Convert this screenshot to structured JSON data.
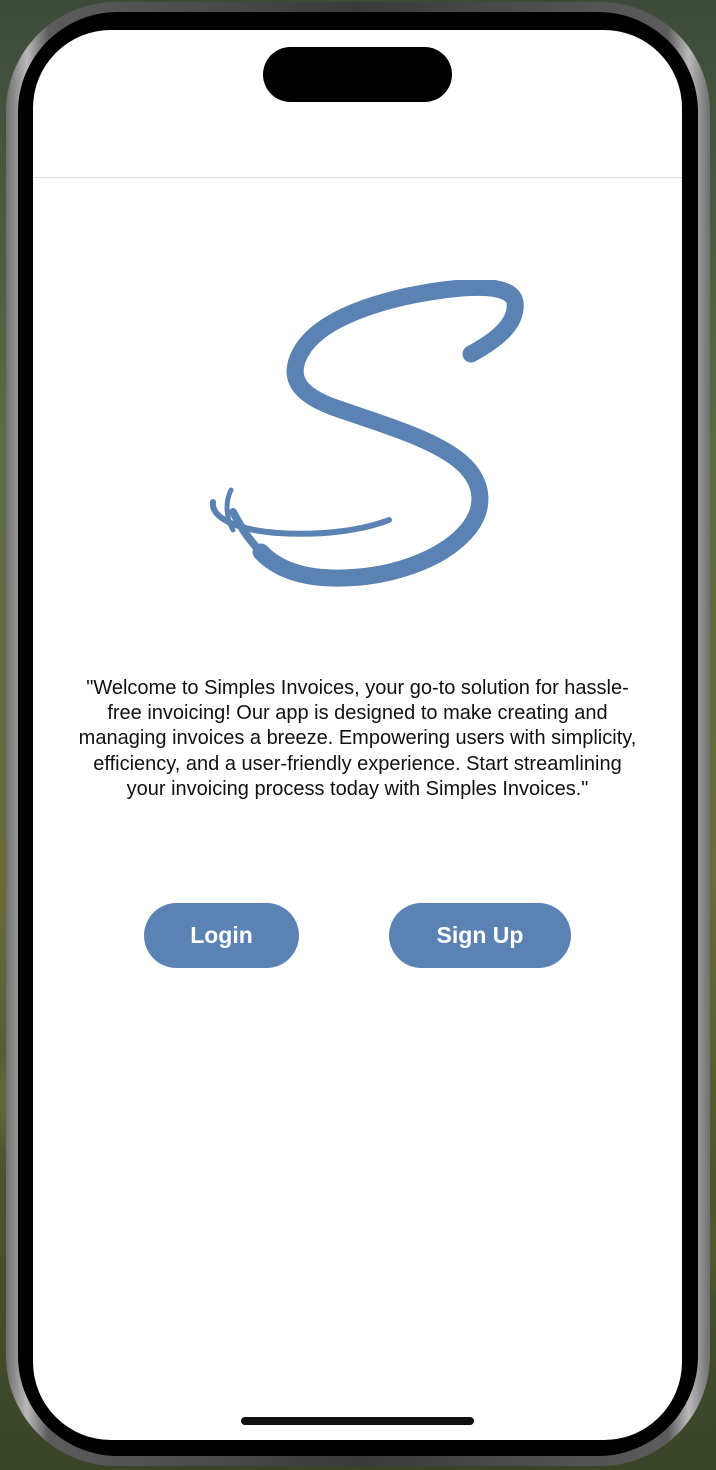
{
  "welcome": {
    "message": "\"Welcome to Simples Invoices, your go-to solution for hassle-free invoicing! Our app is designed to make creating and managing invoices a breeze. Empowering users with simplicity, efficiency, and a user-friendly experience. Start streamlining your invoicing process today with Simples Invoices.\""
  },
  "buttons": {
    "login_label": "Login",
    "signup_label": "Sign Up"
  },
  "logo": {
    "icon": "script-s-logo",
    "color": "#5a82b2"
  },
  "colors": {
    "accent": "#5a82b2",
    "background": "#ffffff",
    "text": "#111111"
  }
}
